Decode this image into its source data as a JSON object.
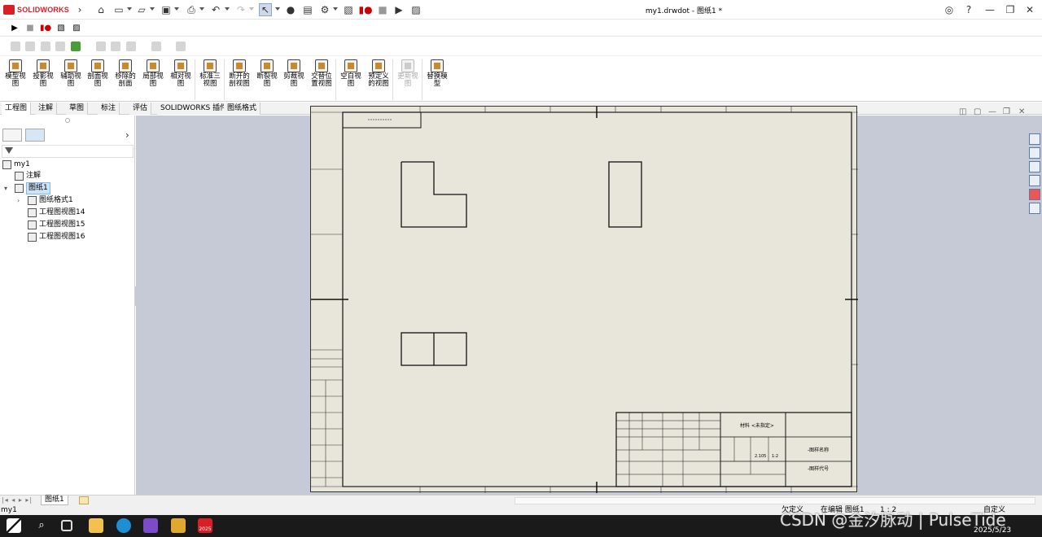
{
  "app": {
    "logo_text": "SOLIDWORKS",
    "document_title": "my1.drwdot - 图纸1 *"
  },
  "ribbon": {
    "buttons": [
      "模型视\n图",
      "投影视\n图",
      "辅助视\n图",
      "剖面视\n图",
      "移除的\n剖面",
      "局部视\n图",
      "相对视\n图",
      "标准三\n视图",
      "断开的\n剖视图",
      "断裂视\n图",
      "剪裁视\n图",
      "交替位\n置视图",
      "空白视\n图",
      "预定义\n的视图",
      "更新视\n图",
      "替换模\n型"
    ]
  },
  "command_tabs": [
    "工程图",
    "注解",
    "草图",
    "标注",
    "评估",
    "SOLIDWORKS 插件",
    "图纸格式"
  ],
  "tree": {
    "root": "my1",
    "annotations": "注解",
    "sheet": "图纸1",
    "sheet_format": "图纸格式1",
    "views": [
      "工程图视图14",
      "工程图视图15",
      "工程图视图16"
    ]
  },
  "sheet_tab": "图纸1",
  "status": {
    "left": "my1",
    "undefined": "欠定义",
    "editing": "在编辑 图纸1",
    "scale": "1 : 2",
    "custom": "自定义"
  },
  "taskbar": {
    "date": "2025/5/23",
    "sw_badge": "2025"
  },
  "watermark": "CSDN @金汐脉动 | PulseTide",
  "title_block": {
    "material": "材料 <未指定>",
    "drawing_name": "-图样名称",
    "drawing_code": "-图样代号",
    "scale_value": "1:2",
    "weight_value": "2.105"
  }
}
